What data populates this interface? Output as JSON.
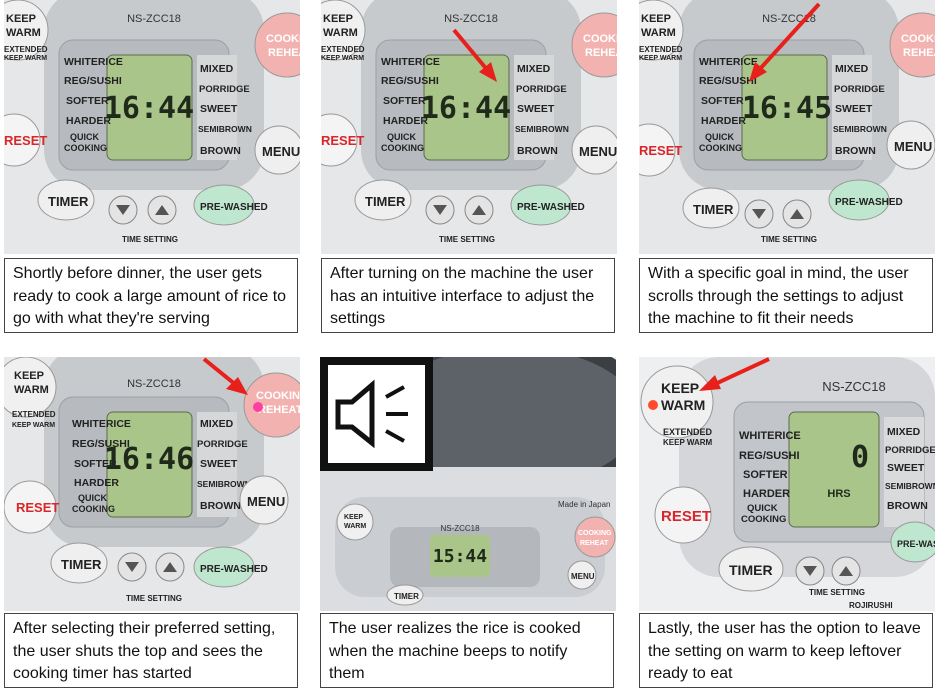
{
  "model": "NS-ZCC18",
  "panels": [
    {
      "time": "16:44",
      "caption": "Shortly before dinner, the user gets ready to cook a large amount of rice to go with what they're serving"
    },
    {
      "time": "16:44",
      "caption": "After turning on the machine the user has an intuitive interface to adjust the settings"
    },
    {
      "time": "16:45",
      "caption": "With a specific goal in mind, the user scrolls through the settings to adjust the machine to fit their needs"
    },
    {
      "time": "16:46",
      "caption": "After selecting their preferred setting, the user shuts the top and sees the cooking timer has started"
    },
    {
      "time": "15:44",
      "caption": "The user realizes the rice is cooked when the machine beeps to notify them",
      "made_in": "Made in Japan"
    },
    {
      "time": "0",
      "hrs": "HRS",
      "caption": "Lastly, the user has the option to leave the setting on warm to keep leftover ready to eat",
      "brand_fragment": "ROJIRUSHI"
    }
  ],
  "labels": {
    "keep_warm_1": "KEEP",
    "keep_warm_2": "WARM",
    "extended_1": "EXTENDED",
    "extended_2": "KEEP WARM",
    "reset": "RESET",
    "cooking_1": "COOKING",
    "cooking_2": "REHEAT",
    "menu": "MENU",
    "timer": "TIMER",
    "prewashed": "PRE-WASHED",
    "time_setting": "TIME SETTING",
    "left_menu": [
      "WHITERICE",
      "REG/SUSHI",
      "SOFTER",
      "HARDER",
      "QUICK",
      "COOKING"
    ],
    "right_menu": [
      "MIXED",
      "PORRIDGE",
      "SWEET",
      "SEMIBROWN",
      "BROWN"
    ]
  },
  "colors": {
    "arrow": "#e8201c",
    "pink_button": "#f2b3b0",
    "green_button": "#bfe7cf",
    "lcd": "#a9c58a",
    "panel_silver": "#c9ccd0"
  }
}
